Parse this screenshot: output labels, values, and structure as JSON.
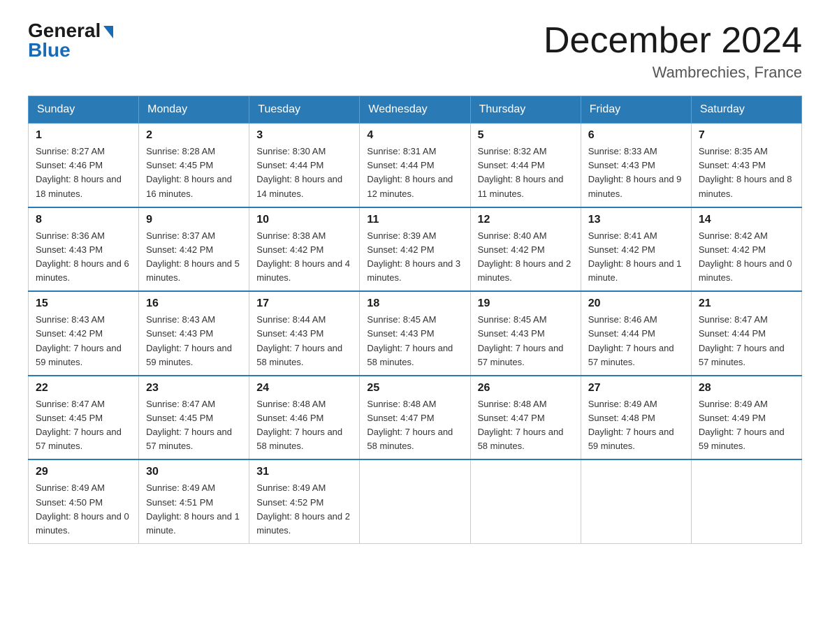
{
  "header": {
    "logo": {
      "general": "General",
      "blue": "Blue",
      "arrow_color": "#1a6bb5"
    },
    "title": "December 2024",
    "location": "Wambrechies, France"
  },
  "weekdays": [
    "Sunday",
    "Monday",
    "Tuesday",
    "Wednesday",
    "Thursday",
    "Friday",
    "Saturday"
  ],
  "weeks": [
    [
      {
        "day": "1",
        "sunrise": "Sunrise: 8:27 AM",
        "sunset": "Sunset: 4:46 PM",
        "daylight": "Daylight: 8 hours and 18 minutes."
      },
      {
        "day": "2",
        "sunrise": "Sunrise: 8:28 AM",
        "sunset": "Sunset: 4:45 PM",
        "daylight": "Daylight: 8 hours and 16 minutes."
      },
      {
        "day": "3",
        "sunrise": "Sunrise: 8:30 AM",
        "sunset": "Sunset: 4:44 PM",
        "daylight": "Daylight: 8 hours and 14 minutes."
      },
      {
        "day": "4",
        "sunrise": "Sunrise: 8:31 AM",
        "sunset": "Sunset: 4:44 PM",
        "daylight": "Daylight: 8 hours and 12 minutes."
      },
      {
        "day": "5",
        "sunrise": "Sunrise: 8:32 AM",
        "sunset": "Sunset: 4:44 PM",
        "daylight": "Daylight: 8 hours and 11 minutes."
      },
      {
        "day": "6",
        "sunrise": "Sunrise: 8:33 AM",
        "sunset": "Sunset: 4:43 PM",
        "daylight": "Daylight: 8 hours and 9 minutes."
      },
      {
        "day": "7",
        "sunrise": "Sunrise: 8:35 AM",
        "sunset": "Sunset: 4:43 PM",
        "daylight": "Daylight: 8 hours and 8 minutes."
      }
    ],
    [
      {
        "day": "8",
        "sunrise": "Sunrise: 8:36 AM",
        "sunset": "Sunset: 4:43 PM",
        "daylight": "Daylight: 8 hours and 6 minutes."
      },
      {
        "day": "9",
        "sunrise": "Sunrise: 8:37 AM",
        "sunset": "Sunset: 4:42 PM",
        "daylight": "Daylight: 8 hours and 5 minutes."
      },
      {
        "day": "10",
        "sunrise": "Sunrise: 8:38 AM",
        "sunset": "Sunset: 4:42 PM",
        "daylight": "Daylight: 8 hours and 4 minutes."
      },
      {
        "day": "11",
        "sunrise": "Sunrise: 8:39 AM",
        "sunset": "Sunset: 4:42 PM",
        "daylight": "Daylight: 8 hours and 3 minutes."
      },
      {
        "day": "12",
        "sunrise": "Sunrise: 8:40 AM",
        "sunset": "Sunset: 4:42 PM",
        "daylight": "Daylight: 8 hours and 2 minutes."
      },
      {
        "day": "13",
        "sunrise": "Sunrise: 8:41 AM",
        "sunset": "Sunset: 4:42 PM",
        "daylight": "Daylight: 8 hours and 1 minute."
      },
      {
        "day": "14",
        "sunrise": "Sunrise: 8:42 AM",
        "sunset": "Sunset: 4:42 PM",
        "daylight": "Daylight: 8 hours and 0 minutes."
      }
    ],
    [
      {
        "day": "15",
        "sunrise": "Sunrise: 8:43 AM",
        "sunset": "Sunset: 4:42 PM",
        "daylight": "Daylight: 7 hours and 59 minutes."
      },
      {
        "day": "16",
        "sunrise": "Sunrise: 8:43 AM",
        "sunset": "Sunset: 4:43 PM",
        "daylight": "Daylight: 7 hours and 59 minutes."
      },
      {
        "day": "17",
        "sunrise": "Sunrise: 8:44 AM",
        "sunset": "Sunset: 4:43 PM",
        "daylight": "Daylight: 7 hours and 58 minutes."
      },
      {
        "day": "18",
        "sunrise": "Sunrise: 8:45 AM",
        "sunset": "Sunset: 4:43 PM",
        "daylight": "Daylight: 7 hours and 58 minutes."
      },
      {
        "day": "19",
        "sunrise": "Sunrise: 8:45 AM",
        "sunset": "Sunset: 4:43 PM",
        "daylight": "Daylight: 7 hours and 57 minutes."
      },
      {
        "day": "20",
        "sunrise": "Sunrise: 8:46 AM",
        "sunset": "Sunset: 4:44 PM",
        "daylight": "Daylight: 7 hours and 57 minutes."
      },
      {
        "day": "21",
        "sunrise": "Sunrise: 8:47 AM",
        "sunset": "Sunset: 4:44 PM",
        "daylight": "Daylight: 7 hours and 57 minutes."
      }
    ],
    [
      {
        "day": "22",
        "sunrise": "Sunrise: 8:47 AM",
        "sunset": "Sunset: 4:45 PM",
        "daylight": "Daylight: 7 hours and 57 minutes."
      },
      {
        "day": "23",
        "sunrise": "Sunrise: 8:47 AM",
        "sunset": "Sunset: 4:45 PM",
        "daylight": "Daylight: 7 hours and 57 minutes."
      },
      {
        "day": "24",
        "sunrise": "Sunrise: 8:48 AM",
        "sunset": "Sunset: 4:46 PM",
        "daylight": "Daylight: 7 hours and 58 minutes."
      },
      {
        "day": "25",
        "sunrise": "Sunrise: 8:48 AM",
        "sunset": "Sunset: 4:47 PM",
        "daylight": "Daylight: 7 hours and 58 minutes."
      },
      {
        "day": "26",
        "sunrise": "Sunrise: 8:48 AM",
        "sunset": "Sunset: 4:47 PM",
        "daylight": "Daylight: 7 hours and 58 minutes."
      },
      {
        "day": "27",
        "sunrise": "Sunrise: 8:49 AM",
        "sunset": "Sunset: 4:48 PM",
        "daylight": "Daylight: 7 hours and 59 minutes."
      },
      {
        "day": "28",
        "sunrise": "Sunrise: 8:49 AM",
        "sunset": "Sunset: 4:49 PM",
        "daylight": "Daylight: 7 hours and 59 minutes."
      }
    ],
    [
      {
        "day": "29",
        "sunrise": "Sunrise: 8:49 AM",
        "sunset": "Sunset: 4:50 PM",
        "daylight": "Daylight: 8 hours and 0 minutes."
      },
      {
        "day": "30",
        "sunrise": "Sunrise: 8:49 AM",
        "sunset": "Sunset: 4:51 PM",
        "daylight": "Daylight: 8 hours and 1 minute."
      },
      {
        "day": "31",
        "sunrise": "Sunrise: 8:49 AM",
        "sunset": "Sunset: 4:52 PM",
        "daylight": "Daylight: 8 hours and 2 minutes."
      },
      null,
      null,
      null,
      null
    ]
  ]
}
